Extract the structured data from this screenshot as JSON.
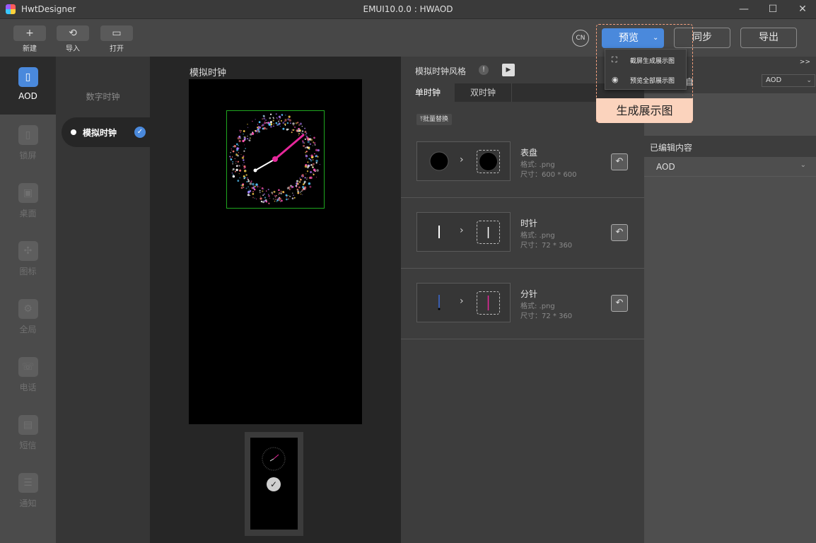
{
  "titlebar": {
    "app_name": "HwtDesigner",
    "window_title": "EMUI10.0.0 : HWAOD",
    "minimize_icon": "minimize-icon",
    "maximize_icon": "maximize-icon",
    "close_icon": "close-icon"
  },
  "toolbar": {
    "new_label": "新建",
    "import_label": "导入",
    "open_label": "打开",
    "cn_label": "CN",
    "preview_label": "预览",
    "sync_label": "同步",
    "export_label": "导出"
  },
  "preview_menu": {
    "items": [
      {
        "label": "截屏生成展示图",
        "icon": "screenshot-icon"
      },
      {
        "label": "预览全部展示图",
        "icon": "eye-icon"
      }
    ]
  },
  "annotation": {
    "label": "生成展示图",
    "color": "#f4a07e"
  },
  "leftnav": {
    "items": [
      {
        "label": "AOD",
        "icon": "phone-icon",
        "active": true
      },
      {
        "label": "锁屏",
        "icon": "lock-screen-icon",
        "active": false
      },
      {
        "label": "桌面",
        "icon": "desktop-icon",
        "active": false
      },
      {
        "label": "图标",
        "icon": "icons-grid-icon",
        "active": false
      },
      {
        "label": "全局",
        "icon": "gear-icon",
        "active": false
      },
      {
        "label": "电话",
        "icon": "phone-call-icon",
        "active": false
      },
      {
        "label": "短信",
        "icon": "message-icon",
        "active": false
      },
      {
        "label": "通知",
        "icon": "notification-icon",
        "active": false
      }
    ]
  },
  "styles": {
    "digital_label": "数字时钟",
    "analog_label": "模拟时钟"
  },
  "canvas": {
    "title": "模拟时钟"
  },
  "resources": {
    "title": "模拟时钟风格",
    "tabs": [
      "单时钟",
      "双时钟"
    ],
    "batch_replace": "批量替换",
    "items": [
      {
        "name": "表盘",
        "format": "格式: .png",
        "size": "尺寸：600 * 600"
      },
      {
        "name": "时针",
        "format": "格式: .png",
        "size": "尺寸：72 * 360"
      },
      {
        "name": "分针",
        "format": "格式: .png",
        "size": "尺寸：72 * 360"
      }
    ]
  },
  "right_panel": {
    "expand_label": ">>",
    "row_label": "自",
    "select_value": "AOD",
    "hidden_value": "AOD",
    "edited_title": "已编辑内容",
    "edited_value": "AOD"
  },
  "colors": {
    "accent": "#4a89dc",
    "clock_frame": "#1fa71f",
    "hand_pink": "#e6289b"
  }
}
